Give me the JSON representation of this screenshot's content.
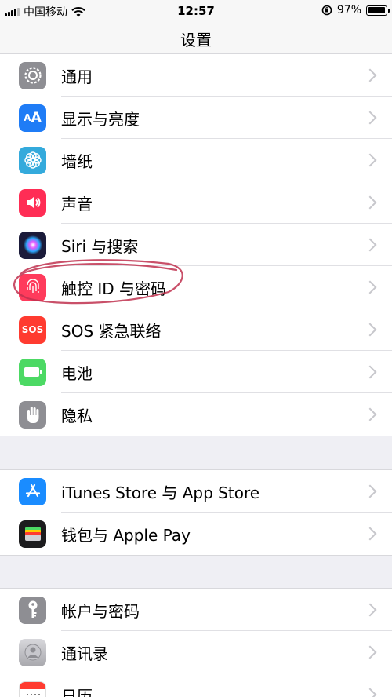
{
  "status_bar": {
    "carrier": "中国移动",
    "time": "12:57",
    "battery": "97%"
  },
  "nav": {
    "title": "设置"
  },
  "groups": [
    {
      "items": [
        {
          "label": "通用",
          "icon": "gear-icon",
          "color": "#8e8e93"
        },
        {
          "label": "显示与亮度",
          "icon": "display-aa-icon",
          "color": "#1f7cf6"
        },
        {
          "label": "墙纸",
          "icon": "wallpaper-flower-icon",
          "color": "#34aadc"
        },
        {
          "label": "声音",
          "icon": "speaker-icon",
          "color": "#ff2d55"
        },
        {
          "label": "Siri 与搜索",
          "icon": "siri-icon",
          "color": "#1b1b3a"
        },
        {
          "label": "触控 ID 与密码",
          "icon": "fingerprint-icon",
          "color": "#ff3b5c"
        },
        {
          "label": "SOS 紧急联络",
          "icon": "sos-icon",
          "color": "#ff3b30",
          "icon_text": "SOS"
        },
        {
          "label": "电池",
          "icon": "battery-icon",
          "color": "#4cd964"
        },
        {
          "label": "隐私",
          "icon": "hand-icon",
          "color": "#8e8e93"
        }
      ]
    },
    {
      "items": [
        {
          "label": "iTunes Store 与 App Store",
          "icon": "app-store-icon",
          "color": "#1a8cff"
        },
        {
          "label": "钱包与 Apple Pay",
          "icon": "wallet-icon",
          "color": "#1c1c1e"
        }
      ]
    },
    {
      "items": [
        {
          "label": "帐户与密码",
          "icon": "key-icon",
          "color": "#8e8e93"
        },
        {
          "label": "通讯录",
          "icon": "contacts-icon",
          "color": "#b0b0b5"
        },
        {
          "label": "日历",
          "icon": "calendar-icon",
          "color": "#ffffff"
        }
      ]
    }
  ]
}
